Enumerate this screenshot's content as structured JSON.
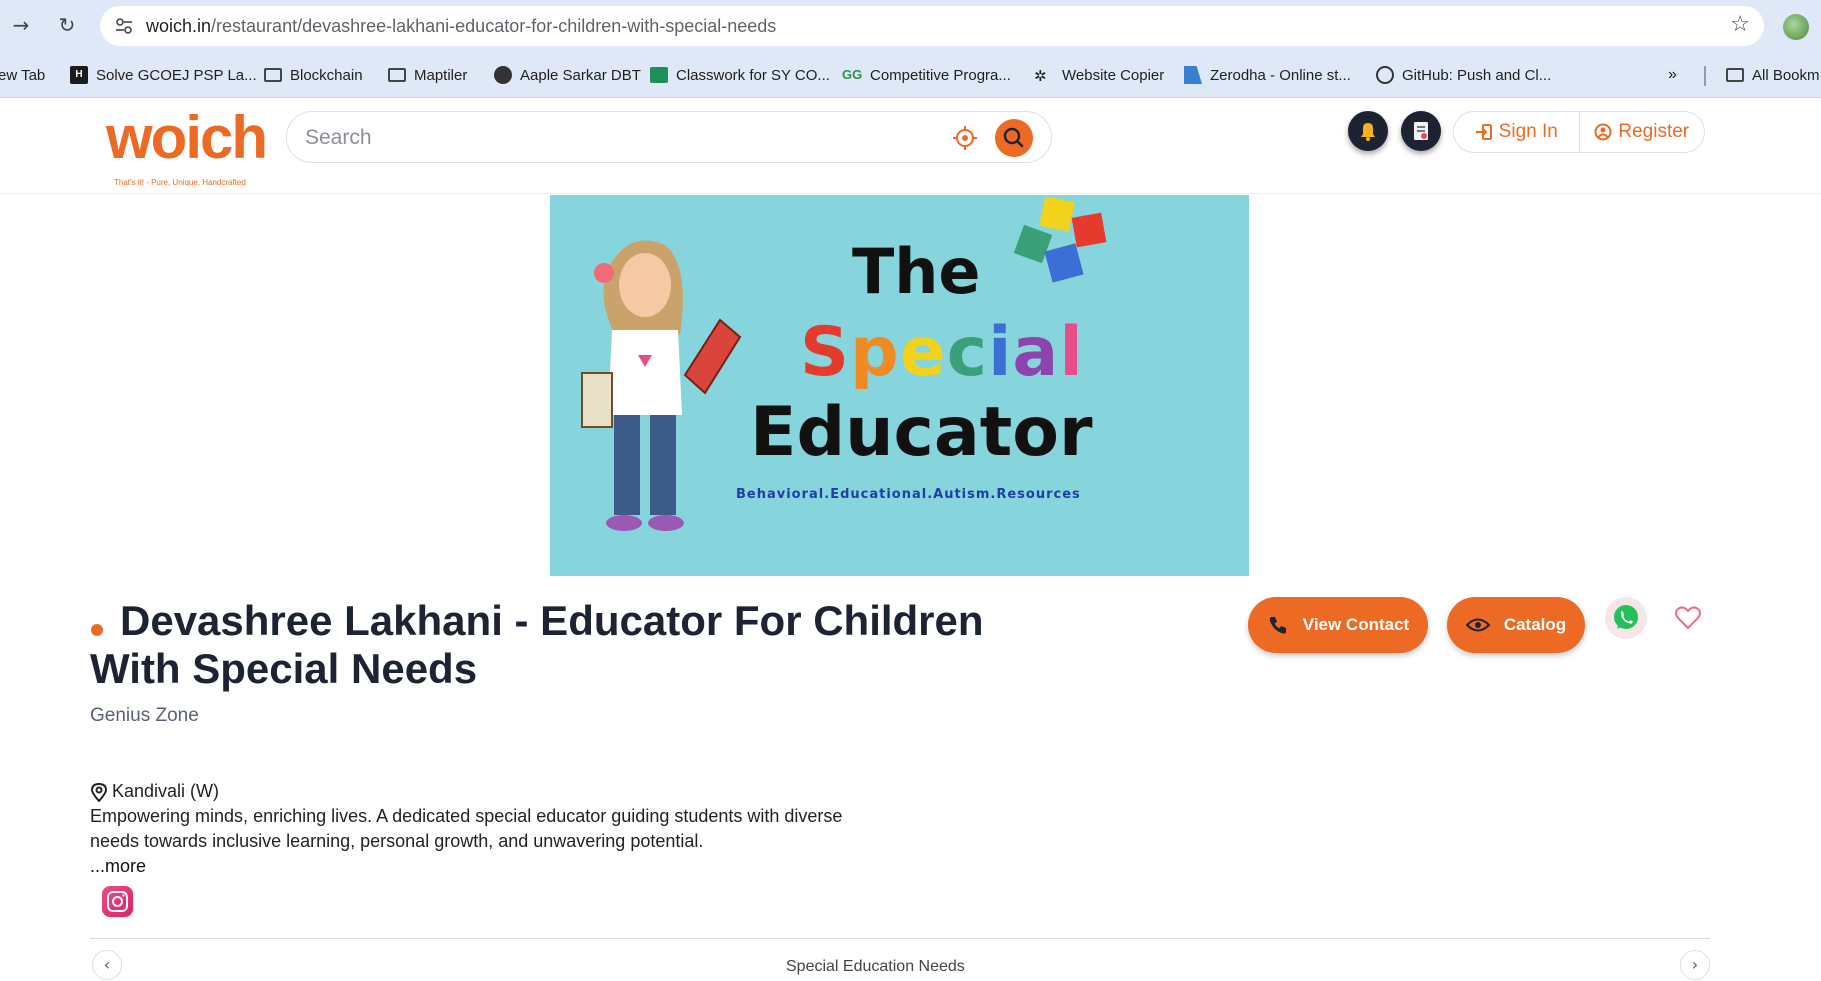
{
  "browser": {
    "url_host": "woich.in",
    "url_path": "/restaurant/devashree-lakhani-educator-for-children-with-special-needs",
    "bookmarks": [
      {
        "label": "ew Tab",
        "icon": "none"
      },
      {
        "label": "Solve GCOEJ PSP La...",
        "icon": "hackerrank-icon"
      },
      {
        "label": "Blockchain",
        "icon": "folder-icon"
      },
      {
        "label": "Maptiler",
        "icon": "folder-icon"
      },
      {
        "label": "Aaple Sarkar DBT",
        "icon": "globe-icon"
      },
      {
        "label": "Classwork for SY CO...",
        "icon": "classroom-icon"
      },
      {
        "label": "Competitive Progra...",
        "icon": "gfg-icon"
      },
      {
        "label": "Website Copier",
        "icon": "bug-icon"
      },
      {
        "label": "Zerodha - Online st...",
        "icon": "zerodha-icon"
      },
      {
        "label": "GitHub: Push and Cl...",
        "icon": "openai-icon"
      }
    ],
    "overflow": "»",
    "all_bookmarks": "All Bookm"
  },
  "header": {
    "logo": "woich",
    "logo_tagline": "That's it! - Pure, Unique, Handcrafted",
    "search_placeholder": "Search",
    "sign_in": "Sign In",
    "register": "Register"
  },
  "banner": {
    "line1": "The",
    "line2": "Special",
    "line3": "Educator",
    "subtitle": "Behavioral.Educational.Autism.Resources"
  },
  "listing": {
    "title": "Devashree Lakhani - Educator For Children With Special Needs",
    "category": "Genius Zone",
    "view_contact": "View Contact",
    "catalog": "Catalog",
    "location": "Kandivali (W)",
    "description": "Empowering minds, enriching lives. A dedicated special educator guiding students with diverse needs towards inclusive learning, personal growth, and unwavering potential.",
    "more": "...more",
    "section_label": "Special Education Needs"
  },
  "colors": {
    "brand": "#ec6a23",
    "dark": "#1d2333",
    "chrome": "#dfe8f6",
    "banner_bg": "#86d4dc"
  }
}
